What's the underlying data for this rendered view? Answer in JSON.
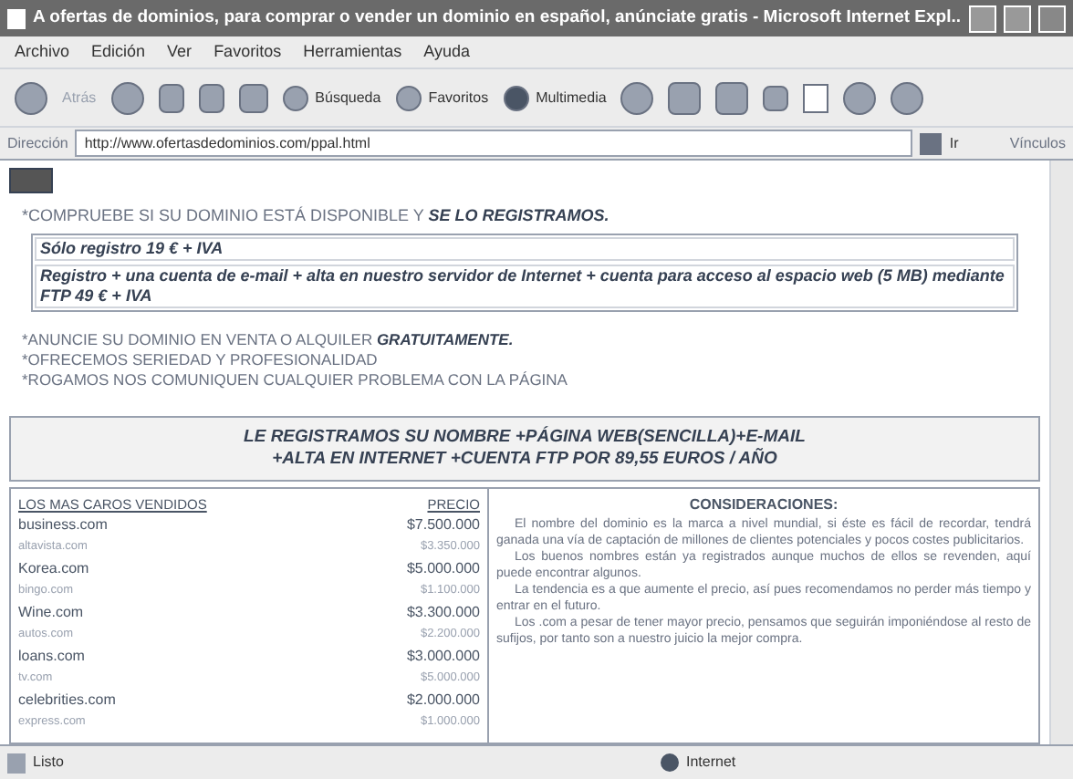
{
  "window": {
    "title": "A ofertas de dominios, para comprar o vender un dominio en español, anúnciate gratis - Microsoft Internet Expl..."
  },
  "menu": [
    "Archivo",
    "Edición",
    "Ver",
    "Favoritos",
    "Herramientas",
    "Ayuda"
  ],
  "toolbar": {
    "back": "Atrás",
    "search": "Búsqueda",
    "favorites": "Favoritos",
    "media": "Multimedia"
  },
  "address": {
    "label": "Dirección",
    "url": "http://www.ofertasdedominios.com/ppal.html",
    "go": "Ir",
    "links": "Vínculos"
  },
  "notice": {
    "text": "*COMPRUEBE SI SU DOMINIO ESTÁ DISPONIBLE Y ",
    "emphasis": "SE LO REGISTRAMOS."
  },
  "offers": [
    "Sólo registro 19 € + IVA",
    "Registro + una cuenta de e-mail + alta en nuestro servidor de Internet + cuenta para acceso al espacio web (5 MB) mediante FTP 49 € + IVA"
  ],
  "bullets": [
    {
      "text": "*ANUNCIE SU DOMINIO EN VENTA O ALQUILER ",
      "emphasis": "GRATUITAMENTE."
    },
    {
      "text": "*OFRECEMOS SERIEDAD Y PROFESIONALIDAD"
    },
    {
      "text": "*ROGAMOS NOS COMUNIQUEN CUALQUIER PROBLEMA CON LA PÁGINA"
    }
  ],
  "banner": [
    "LE REGISTRAMOS SU NOMBRE +PÁGINA WEB(SENCILLA)+E-MAIL",
    "+ALTA EN INTERNET +CUENTA FTP POR 89,55 EUROS / AÑO"
  ],
  "table": {
    "columns": [
      "LOS MAS CAROS VENDIDOS",
      "PRECIO"
    ],
    "rows": [
      {
        "domain": "business.com",
        "price": "$7.500.000",
        "faded": false
      },
      {
        "domain": "altavista.com",
        "price": "$3.350.000",
        "faded": true
      },
      {
        "domain": "Korea.com",
        "price": "$5.000.000",
        "faded": false
      },
      {
        "domain": "bingo.com",
        "price": "$1.100.000",
        "faded": true
      },
      {
        "domain": "Wine.com",
        "price": "$3.300.000",
        "faded": false
      },
      {
        "domain": "autos.com",
        "price": "$2.200.000",
        "faded": true
      },
      {
        "domain": "loans.com",
        "price": "$3.000.000",
        "faded": false
      },
      {
        "domain": "tv.com",
        "price": "$5.000.000",
        "faded": true
      },
      {
        "domain": "celebrities.com",
        "price": "$2.000.000",
        "faded": false
      },
      {
        "domain": "express.com",
        "price": "$1.000.000",
        "faded": true
      }
    ]
  },
  "considerations": {
    "title": "CONSIDERACIONES:",
    "paragraphs": [
      "El nombre del dominio es la marca a nivel mundial, si éste es fácil de recordar, tendrá ganada una vía de captación de millones de clientes potenciales y pocos costes publicitarios.",
      "Los buenos nombres están ya registrados aunque muchos de ellos se revenden, aquí puede encontrar algunos.",
      "La tendencia es a que aumente el precio, así pues recomendamos no perder más tiempo y entrar en el futuro.",
      "Los .com a pesar de tener mayor precio, pensamos que seguirán imponiéndose al resto de sufijos, por tanto son a nuestro juicio la mejor compra."
    ]
  },
  "status_bar": {
    "text": "Listo",
    "zone": "Internet"
  }
}
